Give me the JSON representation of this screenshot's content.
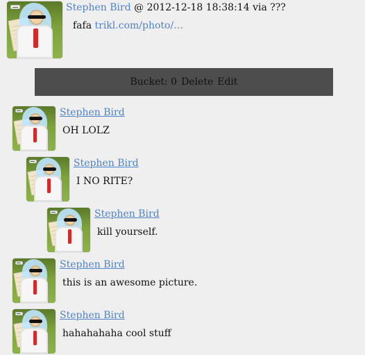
{
  "post": {
    "author": "Stephen Bird",
    "at_sep": "@",
    "datetime": "2012-12-18 18:38:14",
    "via_text": "via ???",
    "text": "fafa",
    "link_text": "trikl.com/photo/…"
  },
  "toolbar": {
    "bucket_label": "Bucket: 0",
    "delete_label": "Delete",
    "edit_label": "Edit"
  },
  "comments": [
    {
      "author": "Stephen Bird",
      "text": "OH LOLZ"
    },
    {
      "author": "Stephen Bird",
      "text": "I NO RITE?"
    },
    {
      "author": "Stephen Bird",
      "text": "kill yourself."
    },
    {
      "author": "Stephen Bird",
      "text": "this is an awesome picture."
    },
    {
      "author": "Stephen Bird",
      "text": "hahahahaha cool stuff"
    }
  ],
  "icons": {
    "avatar": "avatar-icon"
  }
}
